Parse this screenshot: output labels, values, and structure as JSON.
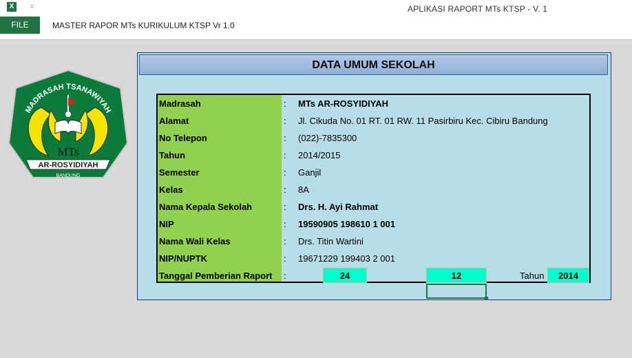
{
  "window": {
    "title": "APLIKASI RAPORT MTs KTSP - V. 1",
    "qat_symbol": "=",
    "excel_icon": "excel-icon"
  },
  "ribbon": {
    "file_label": "FILE",
    "sheet_title": "MASTER RAPOR MTs  KURIKULUM KTSP Vr 1.0"
  },
  "logo": {
    "top_text": "MADRASAH TSANAWIYAH",
    "center_text": "MTs",
    "banner_text": "AR-ROSYIDIYAH",
    "bottom_text": "BANDUNG"
  },
  "panel": {
    "header": "DATA UMUM SEKOLAH",
    "rows": [
      {
        "label": "Madrasah",
        "colon": ":",
        "value": "MTs AR-ROSYIDIYAH"
      },
      {
        "label": "Alamat",
        "colon": ":",
        "value": "Jl. Cikuda No. 01 RT. 01 RW. 11 Pasirbiru Kec. Cibiru Bandung"
      },
      {
        "label": "No Telepon",
        "colon": ":",
        "value": "(022)-7835300"
      },
      {
        "label": "Tahun",
        "colon": ":",
        "value": "2014/2015"
      },
      {
        "label": "Semester",
        "colon": ":",
        "value": "Ganjil"
      },
      {
        "label": "Kelas",
        "colon": ":",
        "value": "8A"
      },
      {
        "label": "Nama Kepala Sekolah",
        "colon": ":",
        "value": "Drs. H. Ayi Rahmat"
      },
      {
        "label": "NIP",
        "colon": ":",
        "value": "19590905 198610 1 001"
      },
      {
        "label": "Nama Wali Kelas",
        "colon": ":",
        "value": "Drs. Titin Wartini"
      },
      {
        "label": "NIP/NUPTK",
        "colon": ":",
        "value": "19671229 199403 2 001"
      }
    ],
    "tanggal": {
      "label": "Tanggal Pemberian Raport",
      "colon": ":",
      "day": "24",
      "month": "12",
      "tahun_label": "Tahun",
      "year": "2014"
    }
  },
  "colors": {
    "panel_bg": "#b7dde8",
    "label_bg": "#92d050",
    "input_bg": "#00ffcc",
    "logo_green": "#0b7a3b",
    "logo_yellow": "#f5e400"
  }
}
